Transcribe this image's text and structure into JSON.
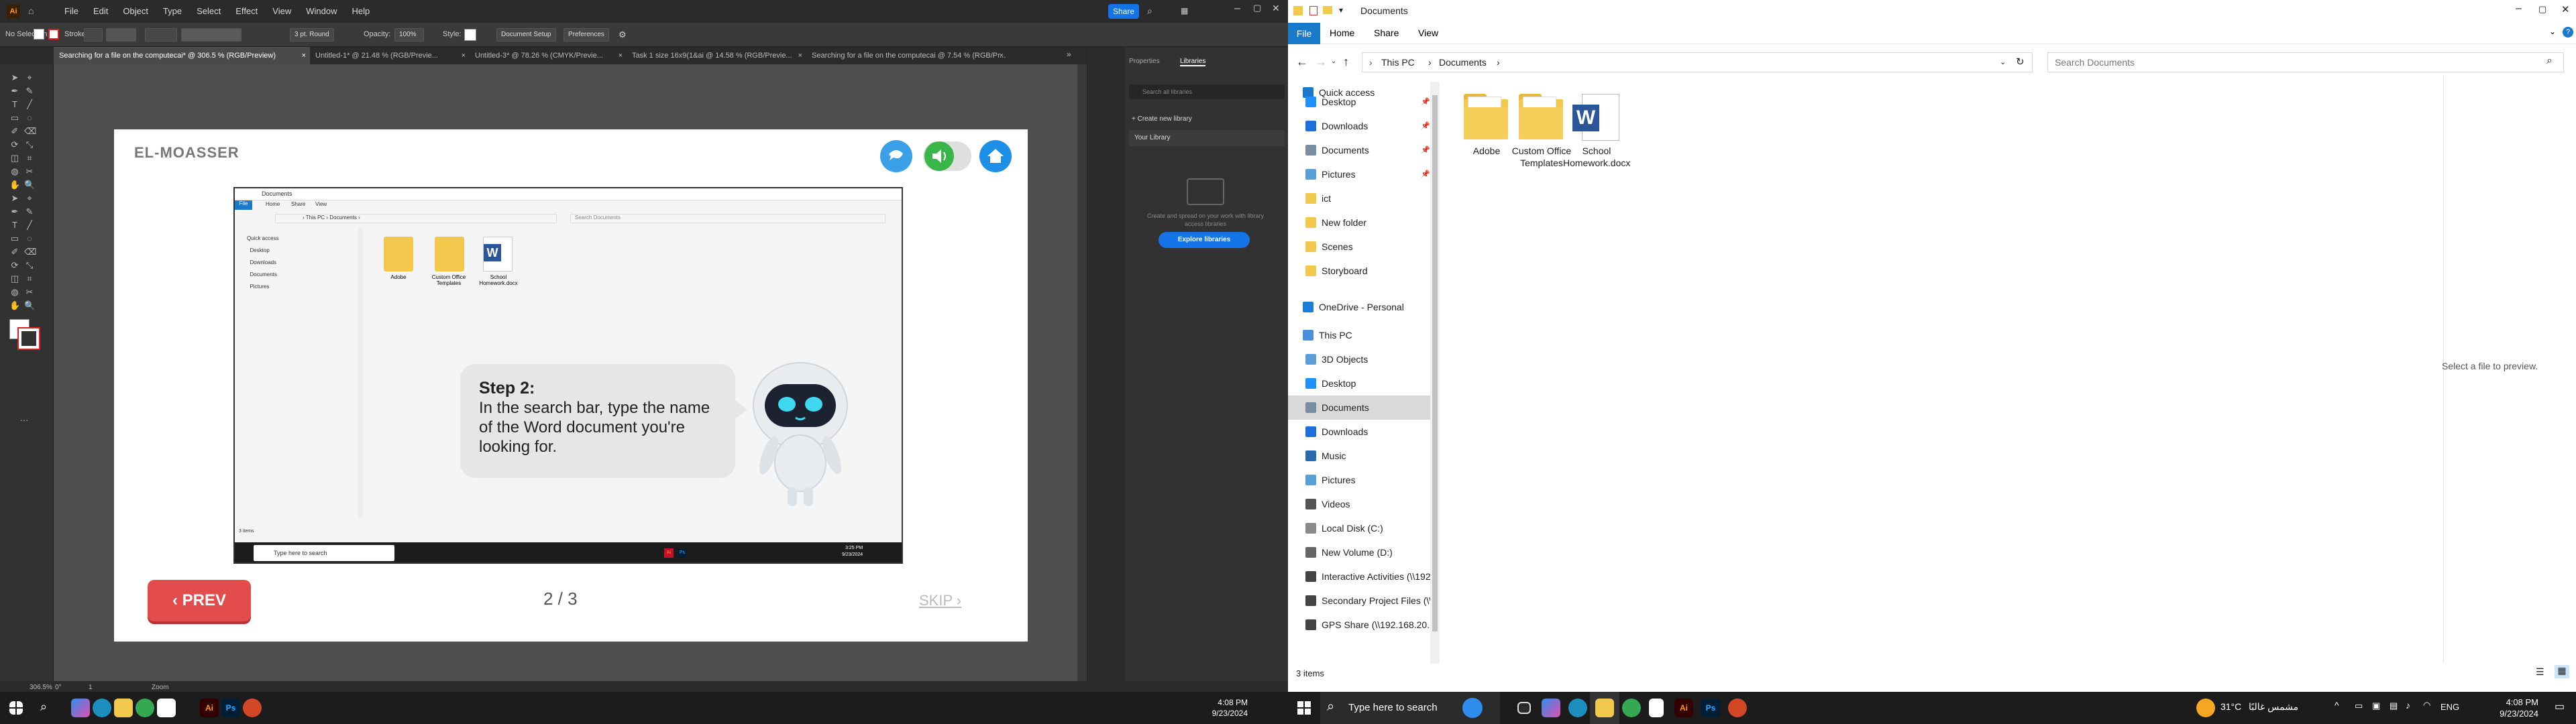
{
  "illustrator": {
    "logo": "Ai",
    "menu": [
      "File",
      "Edit",
      "Object",
      "Type",
      "Select",
      "Effect",
      "View",
      "Window",
      "Help"
    ],
    "share_label": "Share",
    "control_bar": {
      "selection": "No Selection",
      "stroke_label": "Stroke:",
      "stroke_profile": "3 pt. Round",
      "opacity_label": "Opacity:",
      "opacity_value": "100%",
      "style_label": "Style:",
      "doc_setup": "Document Setup",
      "preferences": "Preferences"
    },
    "tabs": [
      "Searching for a file on the computecai* @ 306.5 % (RGB/Preview)",
      "Untitled-1* @ 21.48 % (RGB/Previe...",
      "Untitled-3* @ 78.26 % (CMYK/Previe...",
      "Task 1 size 16x9(1&ai @ 14.58 % (RGB/Previe...",
      "Searching for a file on the computecai @ 7.54 % (RGB/Pr..."
    ],
    "artboard": {
      "brand": "EL-MOASSER",
      "bubble_title": "Step 2:",
      "bubble_text": "In the search bar, type the name of the Word document you're looking for.",
      "prev_label": "PREV",
      "pager": "2 / 3",
      "skip_label": "SKIP"
    },
    "panel": {
      "tab_properties": "Properties",
      "tab_libraries": "Libraries",
      "search_placeholder": "Search all libraries",
      "create_library": "Create new library",
      "your_library": "Your Library",
      "info_text": "Create and spread on your work with library access libraries",
      "explore_label": "Explore libraries"
    },
    "status": {
      "zoom": "306.5%",
      "angle": "0°",
      "page": "1",
      "tool": "Zoom"
    }
  },
  "left_taskbar": {
    "time": "4:08 PM",
    "date": "9/23/2024"
  },
  "explorer": {
    "title": "Documents",
    "ribbon": {
      "file": "File",
      "tabs": [
        "Home",
        "Share",
        "View"
      ]
    },
    "address": {
      "crumbs": [
        "This PC",
        "Documents"
      ]
    },
    "search_placeholder": "Search Documents",
    "nav": [
      {
        "label": "Quick access",
        "type": "star",
        "level": 0
      },
      {
        "label": "Desktop",
        "type": "blue",
        "level": 1,
        "pin": true
      },
      {
        "label": "Downloads",
        "type": "down",
        "level": 1,
        "pin": true
      },
      {
        "label": "Documents",
        "type": "doc",
        "level": 1,
        "pin": true
      },
      {
        "label": "Pictures",
        "type": "pic",
        "level": 1,
        "pin": true
      },
      {
        "label": "ict",
        "type": "folder",
        "level": 1
      },
      {
        "label": "New folder",
        "type": "folder",
        "level": 1
      },
      {
        "label": "Scenes",
        "type": "folder",
        "level": 1
      },
      {
        "label": "Storyboard",
        "type": "folder",
        "level": 1
      },
      {
        "label": "OneDrive - Personal",
        "type": "cloud",
        "level": 0
      },
      {
        "label": "This PC",
        "type": "pc",
        "level": 0
      },
      {
        "label": "3D Objects",
        "type": "cube",
        "level": 1
      },
      {
        "label": "Desktop",
        "type": "blue",
        "level": 1
      },
      {
        "label": "Documents",
        "type": "doc",
        "level": 1,
        "selected": true
      },
      {
        "label": "Downloads",
        "type": "down",
        "level": 1
      },
      {
        "label": "Music",
        "type": "music",
        "level": 1
      },
      {
        "label": "Pictures",
        "type": "pic",
        "level": 1
      },
      {
        "label": "Videos",
        "type": "video",
        "level": 1
      },
      {
        "label": "Local Disk (C:)",
        "type": "disk",
        "level": 1
      },
      {
        "label": "New Volume (D:)",
        "type": "disk2",
        "level": 1
      },
      {
        "label": "Interactive Activities (\\\\192.168.2...",
        "type": "net",
        "level": 1
      },
      {
        "label": "Secondary Project Files (\\\\192.168...",
        "type": "net",
        "level": 1
      },
      {
        "label": "GPS Share (\\\\192.168.20.19) (Z:)",
        "type": "net",
        "level": 1
      }
    ],
    "items": [
      {
        "label": "Adobe",
        "type": "folder"
      },
      {
        "label": "Custom Office Templates",
        "type": "folder"
      },
      {
        "label": "School Homework.docx",
        "type": "word"
      }
    ],
    "preview_text": "Select a file to preview.",
    "status": "3 items"
  },
  "right_taskbar": {
    "search_placeholder": "Type here to search",
    "weather": "31°C",
    "weather_text": "مشمس غالبًا",
    "lang": "ENG",
    "time": "4:08 PM",
    "date": "9/23/2024"
  }
}
